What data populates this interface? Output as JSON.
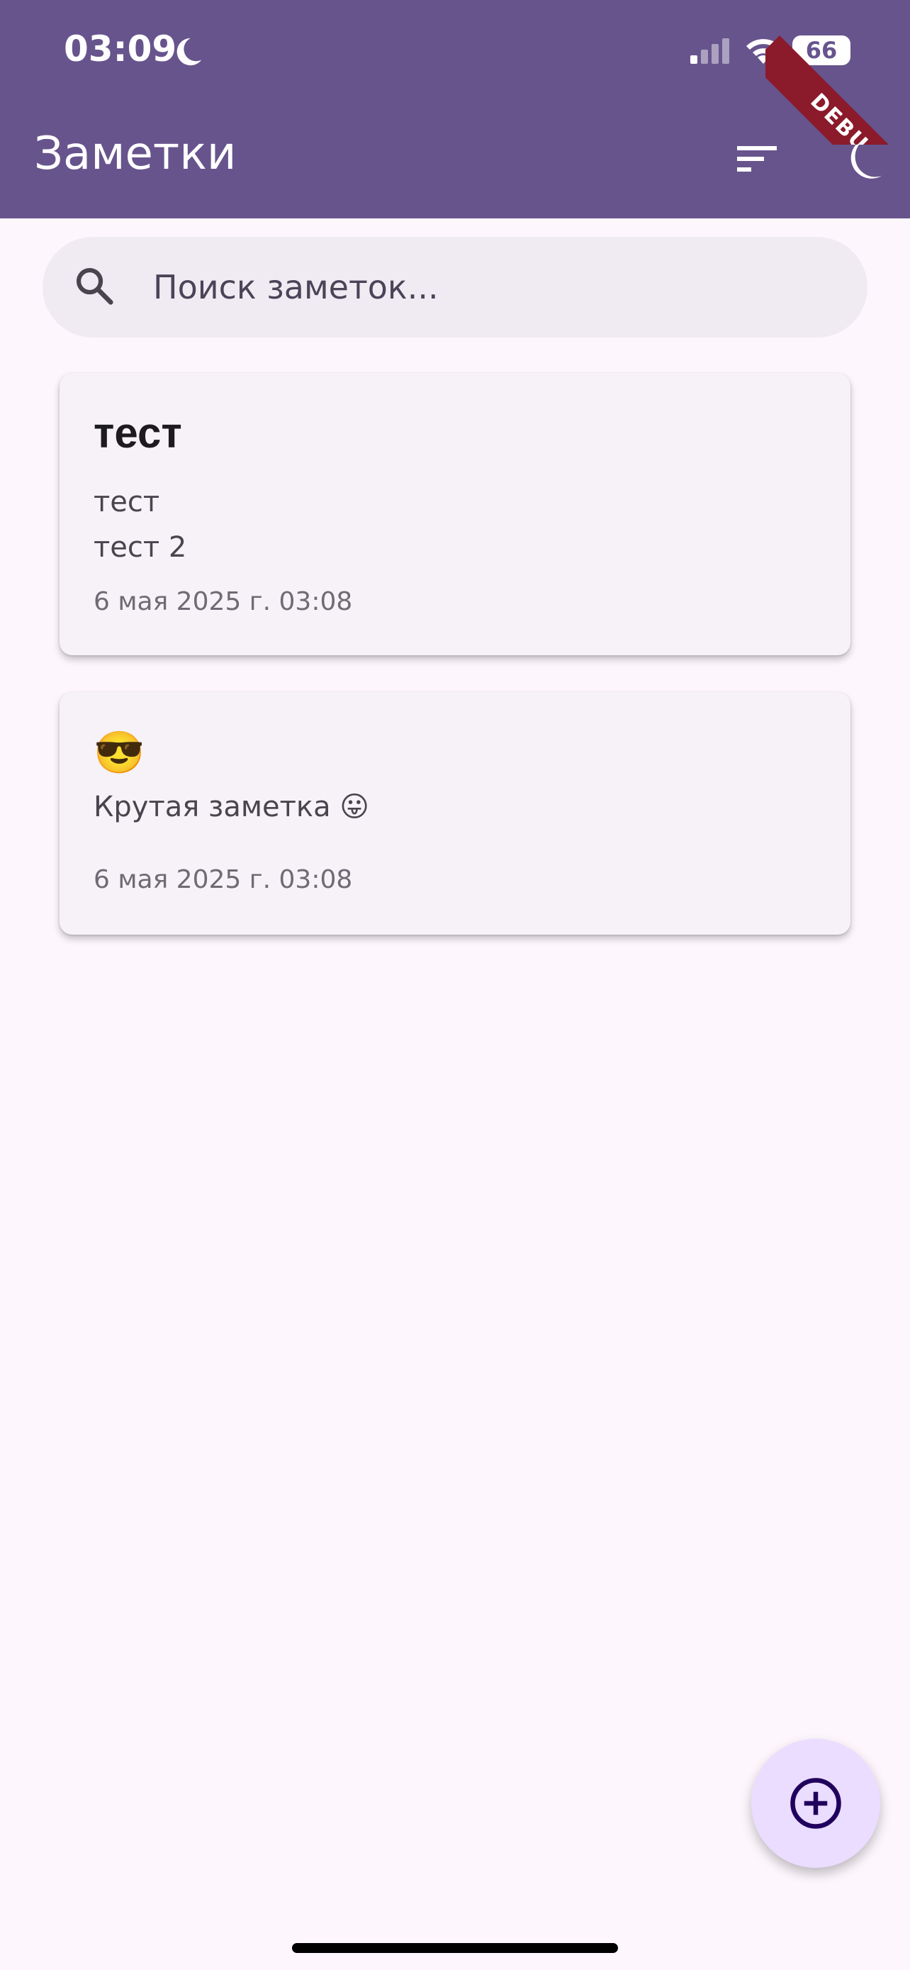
{
  "status_bar": {
    "time": "03:09",
    "battery": "66"
  },
  "debug_banner": "DEBUG",
  "app_bar": {
    "title": "Заметки",
    "sort_icon": "sort-icon",
    "theme_icon": "moon-icon"
  },
  "search": {
    "placeholder": "Поиск заметок...",
    "value": ""
  },
  "notes": [
    {
      "title": "тест",
      "body_lines": [
        "тест",
        "тест 2"
      ],
      "date": "6 мая 2025 г. 03:08"
    },
    {
      "title": "😎",
      "body_lines": [
        "Крутая заметка 😛"
      ],
      "date": "6 мая 2025 г. 03:08"
    }
  ],
  "fab": {
    "icon": "add-circle-icon"
  },
  "colors": {
    "app_bar": "#67548d",
    "background": "#fdf7fd",
    "card": "#f6f2f7",
    "fab": "#eaddff",
    "debug": "#8b1a2b"
  }
}
